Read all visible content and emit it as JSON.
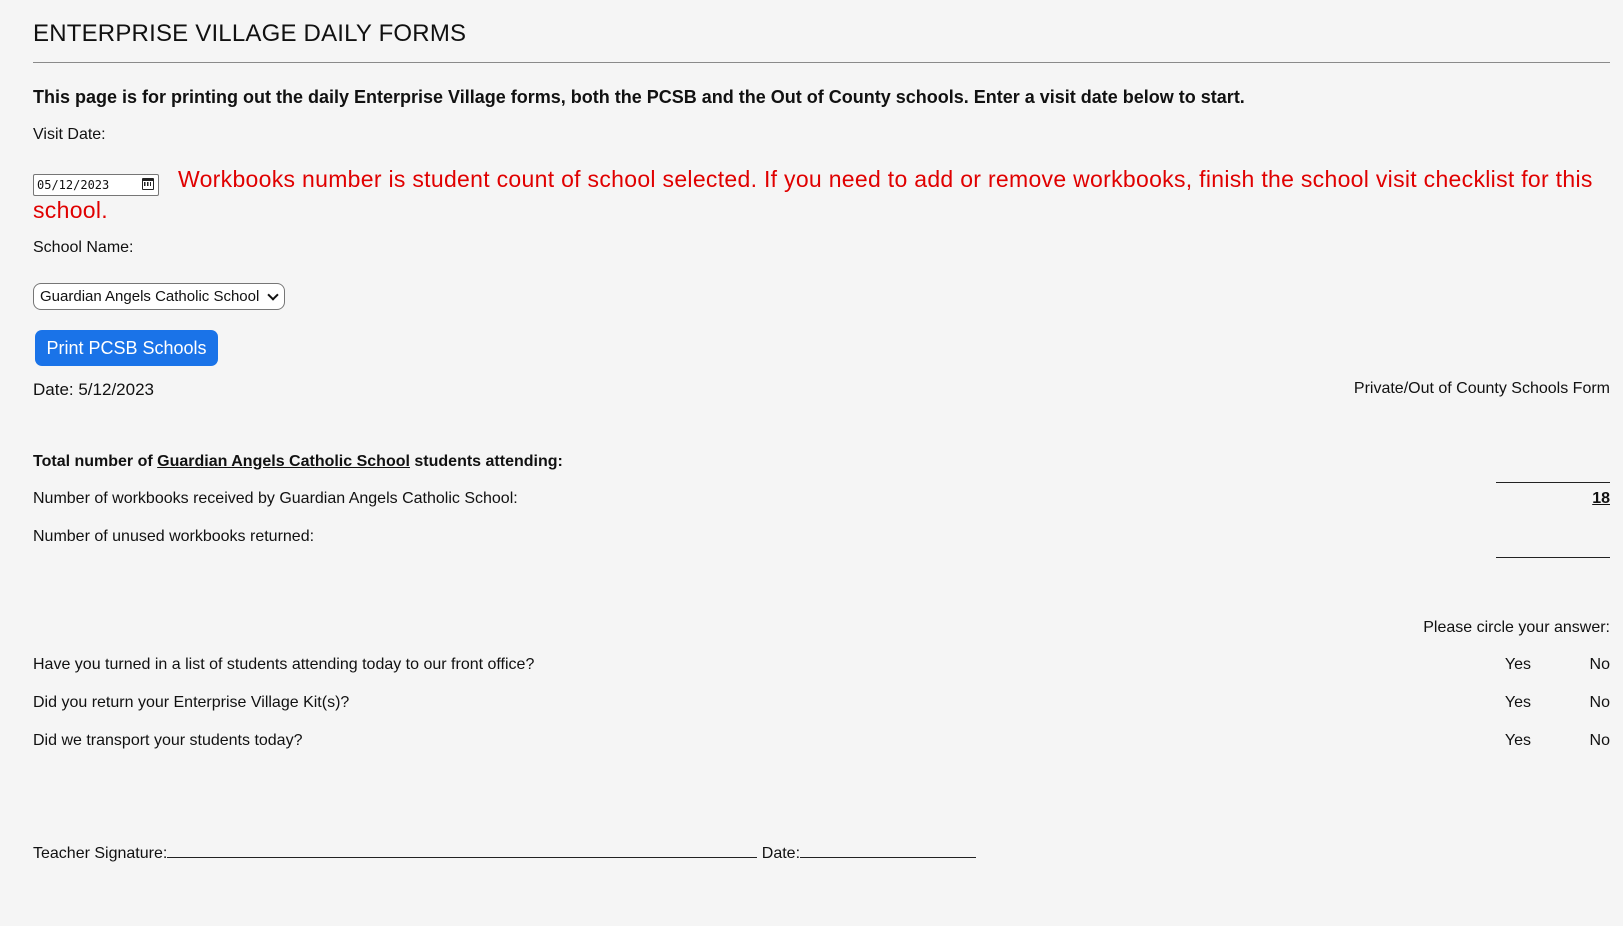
{
  "header": {
    "title": "ENTERPRISE VILLAGE DAILY FORMS"
  },
  "intro": "This page is for printing out the daily Enterprise Village forms, both the PCSB and the Out of County schools. Enter a visit date below to start.",
  "visit_date": {
    "label": "Visit Date:",
    "value": "05/12/2023"
  },
  "warning": "Workbooks number is student count of school selected. If you need to add or remove workbooks, finish the school visit checklist for this school.",
  "school": {
    "label": "School Name:",
    "selected": "Guardian Angels Catholic School"
  },
  "print_button": "Print PCSB Schools",
  "form": {
    "date": "Date: 5/12/2023",
    "form_title": "Private/Out of County Schools Form",
    "total_prefix": "Total number of",
    "total_school": "Guardian Angels Catholic School",
    "total_suffix": "students attending:",
    "workbooks_received_label": "Number of workbooks received by Guardian Angels Catholic School:",
    "workbooks_received_value": "18",
    "unused_label": "Number of unused workbooks returned:",
    "circle_instruction": "Please circle your answer:",
    "questions": [
      {
        "text": "Have you turned in a list of students attending today to our front office?",
        "yes": "Yes",
        "no": "No"
      },
      {
        "text": "Did you return your Enterprise Village Kit(s)?",
        "yes": "Yes",
        "no": "No"
      },
      {
        "text": "Did we transport your students today?",
        "yes": "Yes",
        "no": "No"
      }
    ],
    "teacher_signature_label": "Teacher Signature:",
    "signature_date_label": "Date:"
  }
}
